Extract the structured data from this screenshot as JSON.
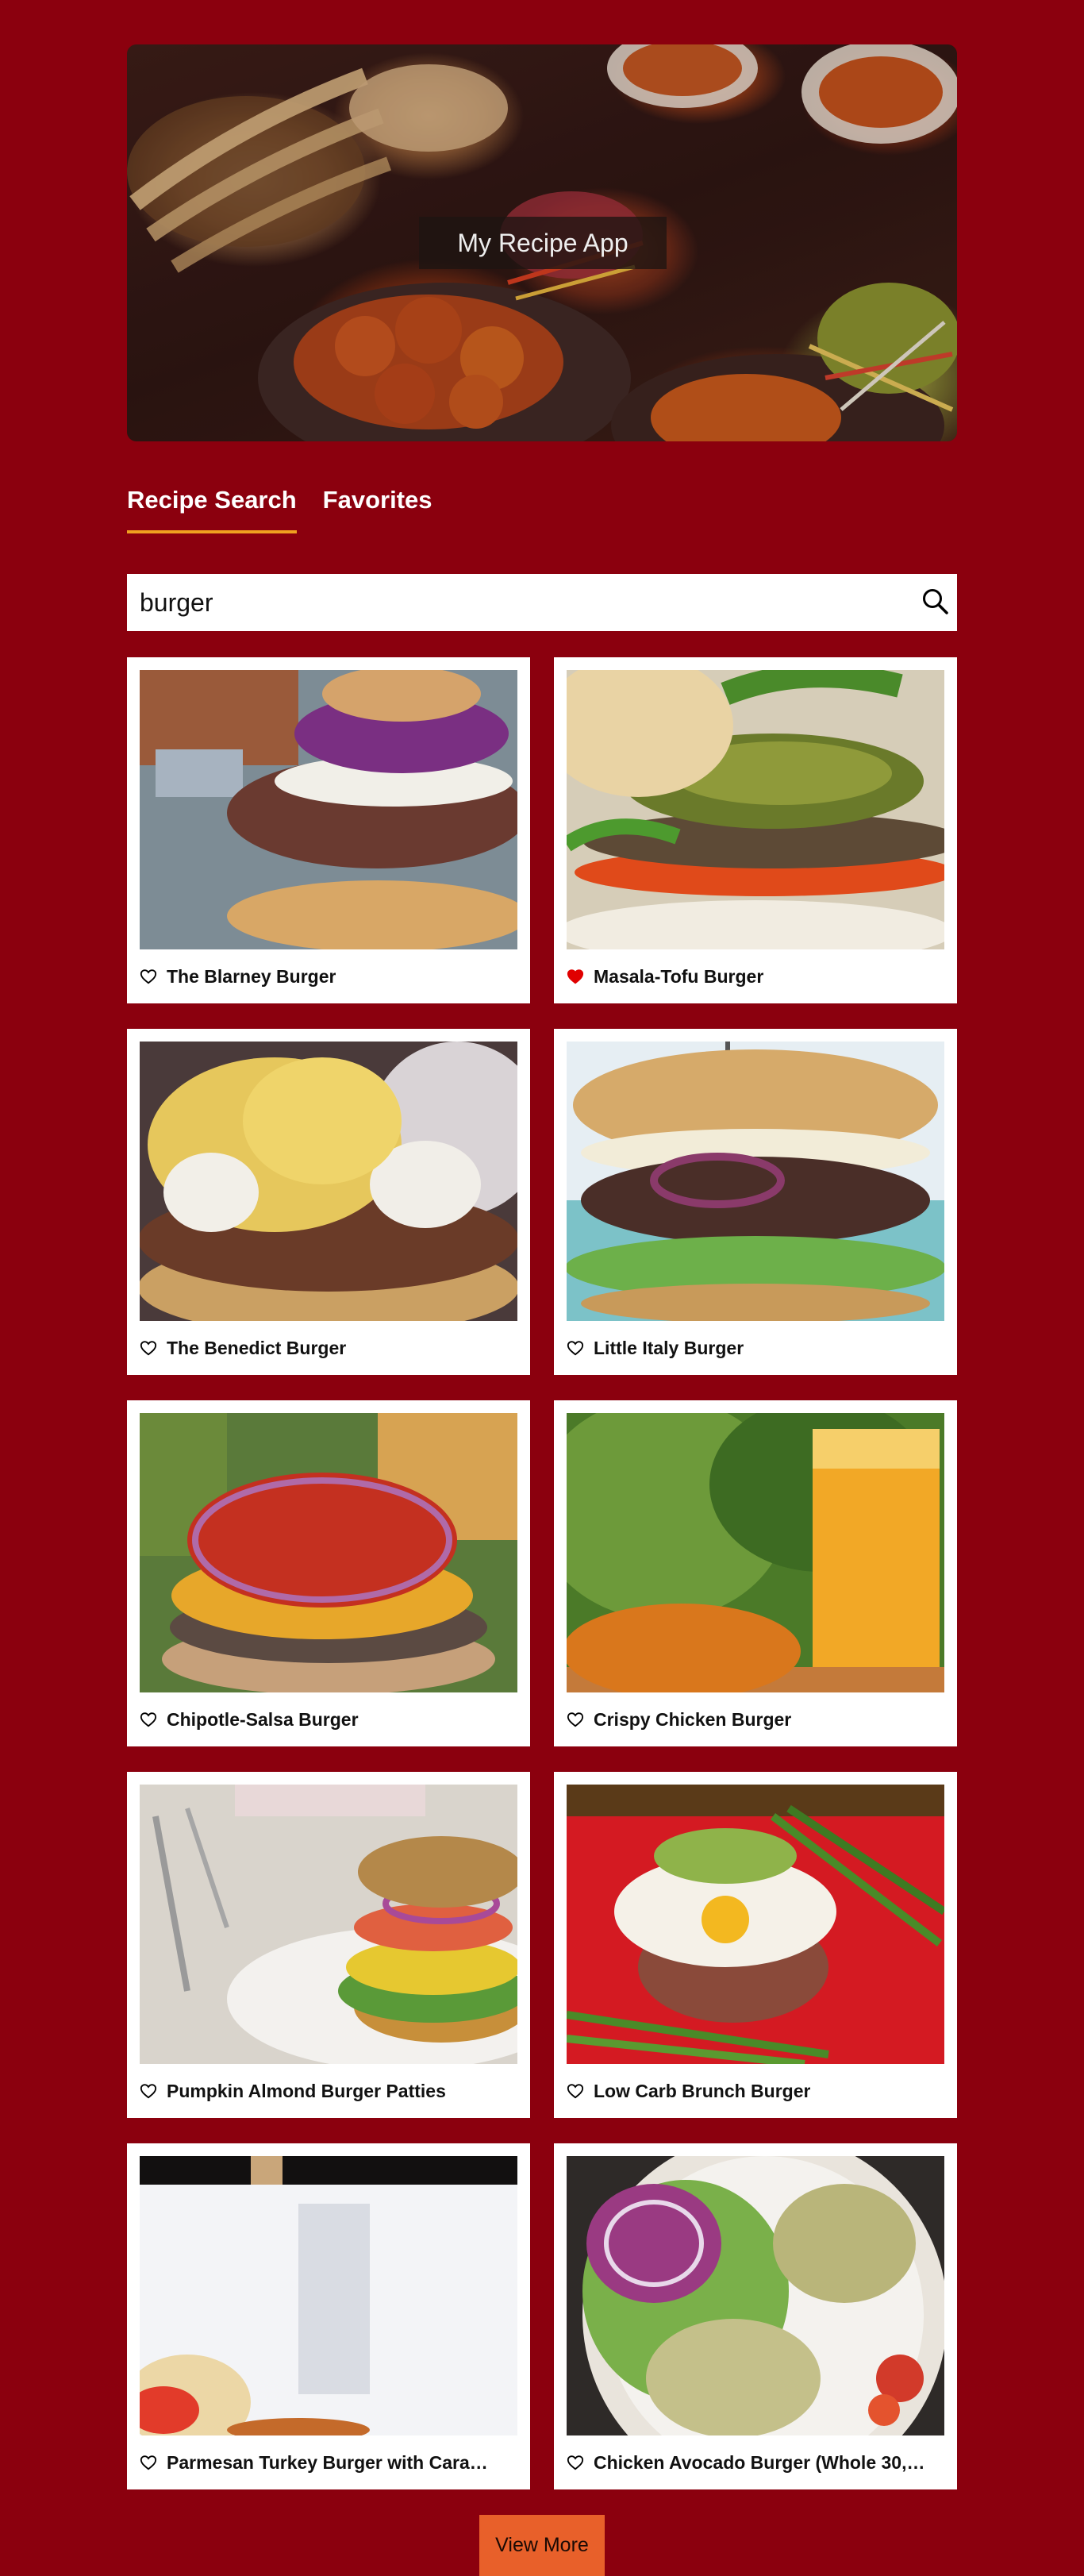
{
  "hero": {
    "title": "My Recipe App"
  },
  "tabs": [
    {
      "label": "Recipe Search",
      "active": true
    },
    {
      "label": "Favorites",
      "active": false
    }
  ],
  "search": {
    "value": "burger",
    "icon": "search-icon"
  },
  "recipes": [
    {
      "title": "The Blarney Burger",
      "favorite": false
    },
    {
      "title": "Masala-Tofu Burger",
      "favorite": true
    },
    {
      "title": "The Benedict Burger",
      "favorite": false
    },
    {
      "title": "Little Italy Burger",
      "favorite": false
    },
    {
      "title": "Chipotle-Salsa Burger",
      "favorite": false
    },
    {
      "title": "Crispy Chicken Burger",
      "favorite": false
    },
    {
      "title": "Pumpkin Almond Burger Patties",
      "favorite": false
    },
    {
      "title": "Low Carb Brunch Burger",
      "favorite": false
    },
    {
      "title": "Parmesan Turkey Burger with Cara…",
      "favorite": false
    },
    {
      "title": "Chicken Avocado Burger (Whole 30,…",
      "favorite": false
    }
  ],
  "view_more": {
    "label": "View More"
  },
  "colors": {
    "background": "#8b000e",
    "tab_underline": "#f0a020",
    "favorite_heart": "#e00000",
    "view_more_button": "#e8602a"
  }
}
